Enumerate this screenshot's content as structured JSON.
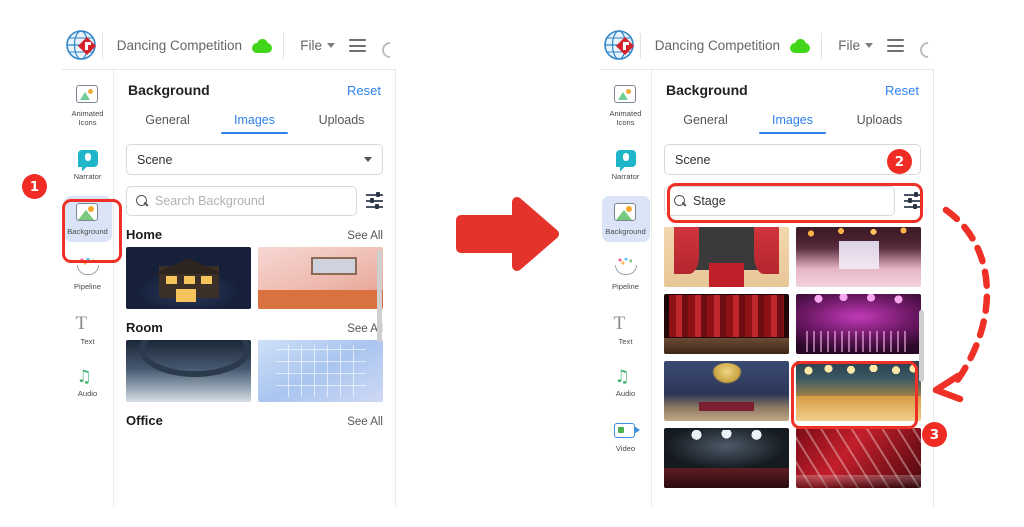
{
  "app": {
    "logo_icon": "globe-diamond-logo",
    "doc_title": "Dancing Competition",
    "cloud_icon": "cloud-saved-icon",
    "file_menu": "File",
    "hamburger_icon": "hamburger-menu-icon",
    "undo_icon": "undo-icon"
  },
  "sidebar": {
    "items": [
      {
        "label": "Animated\nIcons",
        "label_line1": "Animated",
        "label_line2": "Icons",
        "icon": "animated-icons-icon"
      },
      {
        "label": "Narrator",
        "icon": "narrator-microphone-icon"
      },
      {
        "label": "Background",
        "icon": "background-image-icon"
      },
      {
        "label": "Pipeline",
        "icon": "pipeline-icon"
      },
      {
        "label": "Text",
        "icon": "text-icon"
      },
      {
        "label": "Audio",
        "icon": "audio-note-icon"
      },
      {
        "label": "Video",
        "icon": "video-camera-icon"
      }
    ]
  },
  "panel": {
    "title": "Background",
    "reset_label": "Reset",
    "tabs": [
      {
        "label": "General",
        "active": false
      },
      {
        "label": "Images",
        "active": true
      },
      {
        "label": "Uploads",
        "active": false
      }
    ],
    "category_select": {
      "value": "Scene",
      "chevron_icon": "chevron-down-icon"
    },
    "search": {
      "icon": "search-icon",
      "placeholder": "Search Background",
      "value": "Stage",
      "filter_icon": "filter-sliders-icon"
    },
    "see_all_label": "See All"
  },
  "left_window": {
    "sections": [
      {
        "title": "Home",
        "see_all": "See All",
        "thumbs": [
          "night-cabin-thumbnail",
          "pink-room-thumbnail"
        ]
      },
      {
        "title": "Room",
        "see_all": "See All",
        "thumbs": [
          "night-sky-thumbnail",
          "blue-empty-room-thumbnail"
        ]
      },
      {
        "title": "Office",
        "see_all": "See All",
        "thumbs": []
      }
    ]
  },
  "right_window": {
    "results": [
      "red-carpet-stage-thumbnail",
      "ballroom-runway-thumbnail",
      "red-curtain-stage-thumbnail",
      "purple-concert-stage-thumbnail",
      "chandelier-ballroom-thumbnail",
      "golden-lit-stage-thumbnail",
      "dark-spotlight-stage-thumbnail",
      "red-laser-stage-thumbnail"
    ],
    "selected_index": 5
  },
  "annotations": {
    "step1": "1",
    "step2": "2",
    "step3": "3",
    "transition_arrow_icon": "right-arrow-icon",
    "curved_arrow_icon": "curved-dashed-arrow-icon",
    "accent_color": "#ef2b24",
    "link_color": "#2f80ed"
  }
}
